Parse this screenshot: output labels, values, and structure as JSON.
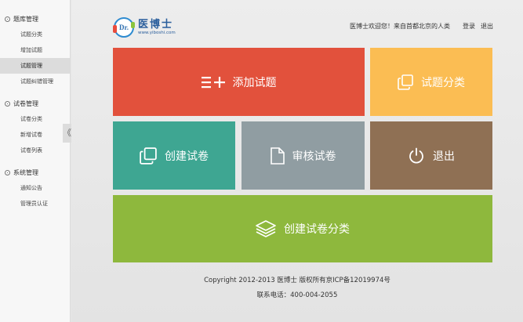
{
  "sidebar": {
    "groups": [
      {
        "title": "题库管理",
        "icon": "gear-icon",
        "items": [
          {
            "label": "试题分类"
          },
          {
            "label": "增加试题"
          },
          {
            "label": "试题管理"
          },
          {
            "label": "试题纠错管理"
          }
        ]
      },
      {
        "title": "试卷管理",
        "icon": "gear-icon",
        "items": [
          {
            "label": "试卷分类"
          },
          {
            "label": "新增试卷"
          },
          {
            "label": "试卷列表"
          }
        ]
      },
      {
        "title": "系统管理",
        "icon": "gear-icon",
        "items": [
          {
            "label": "通知公告"
          },
          {
            "label": "管理员认证"
          }
        ]
      }
    ],
    "active_item": "试题管理",
    "collapse_glyph": "《"
  },
  "header": {
    "logo_mark": "Dr.",
    "logo_name": "医博士",
    "logo_url": "www.yiboshi.com",
    "welcome": "医博士欢迎您！来自首都北京的人类",
    "login": "登录",
    "logout": "退出"
  },
  "tiles": {
    "add_question": {
      "label": "添加试题",
      "color": "#e2513c",
      "icon": "list-add-icon"
    },
    "question_category": {
      "label": "试题分类",
      "color": "#fbbd53",
      "icon": "copy-icon"
    },
    "create_paper": {
      "label": "创建试卷",
      "color": "#3ea692",
      "icon": "copy-icon"
    },
    "review_paper": {
      "label": "审核试卷",
      "color": "#909da2",
      "icon": "document-icon"
    },
    "exit": {
      "label": "退出",
      "color": "#8f7054",
      "icon": "power-icon"
    },
    "create_paper_category": {
      "label": "创建试卷分类",
      "color": "#8eb83d",
      "icon": "layers-icon"
    }
  },
  "footer": {
    "copyright": "Copyright  2012-2013 医博士 版权所有京ICP备12019974号",
    "contact": "联系电话：400-004-2055"
  }
}
